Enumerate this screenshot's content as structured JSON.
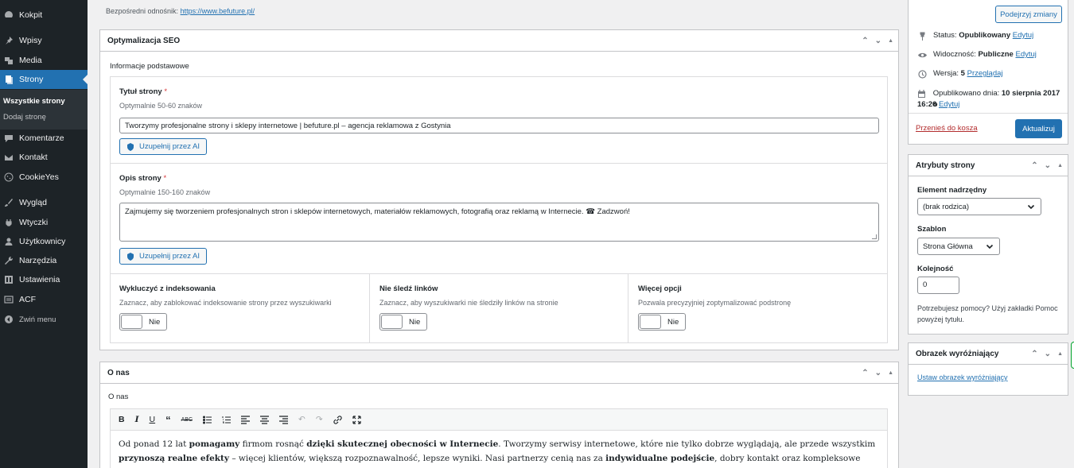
{
  "sidebar": {
    "items": [
      {
        "label": "Kokpit",
        "icon": "dashboard-icon"
      },
      {
        "label": "Wpisy",
        "icon": "pin-icon"
      },
      {
        "label": "Media",
        "icon": "media-icon"
      },
      {
        "label": "Strony",
        "icon": "pages-icon",
        "active": true
      },
      {
        "label": "Komentarze",
        "icon": "comments-icon"
      },
      {
        "label": "Kontakt",
        "icon": "mail-icon"
      },
      {
        "label": "CookieYes",
        "icon": "cookie-icon"
      },
      {
        "label": "Wygląd",
        "icon": "brush-icon"
      },
      {
        "label": "Wtyczki",
        "icon": "plugin-icon"
      },
      {
        "label": "Użytkownicy",
        "icon": "users-icon"
      },
      {
        "label": "Narzędzia",
        "icon": "wrench-icon"
      },
      {
        "label": "Ustawienia",
        "icon": "settings-icon"
      },
      {
        "label": "ACF",
        "icon": "acf-icon"
      },
      {
        "label": "Zwiń menu",
        "icon": "collapse-icon"
      }
    ],
    "submenu": [
      "Wszystkie strony",
      "Dodaj stronę"
    ]
  },
  "permalink": {
    "label": "Bezpośredni odnośnik:",
    "url": "https://www.befuture.pl/"
  },
  "seo": {
    "title": "Optymalizacja SEO",
    "subtitle": "Informacje podstawowe",
    "page_title_label": "Tytuł strony",
    "page_title_hint": "Optymalnie 50-60 znaków",
    "page_title_value": "Tworzymy profesjonalne strony i sklepy internetowe | befuture.pl – agencja reklamowa z Gostynia",
    "ai_button": "Uzupełnij przez AI",
    "desc_label": "Opis strony",
    "desc_hint": "Optymalnie 150-160 znaków",
    "desc_value": "Zajmujemy się tworzeniem profesjonalnych stron i sklepów internetowych, materiałów reklamowych, fotografią oraz reklamą w Internecie. ☎ Zadzwoń!",
    "required_mark": "*",
    "options": [
      {
        "label": "Wykluczyć z indeksowania",
        "hint": "Zaznacz, aby zablokować indeksowanie strony przez wyszukiwarki",
        "toggle": "Nie"
      },
      {
        "label": "Nie śledź linków",
        "hint": "Zaznacz, aby wyszukiwarki nie śledziły linków na stronie",
        "toggle": "Nie"
      },
      {
        "label": "Więcej opcji",
        "hint": "Pozwala precyzyjniej zoptymalizować podstronę",
        "toggle": "Nie"
      }
    ]
  },
  "about": {
    "title": "O nas",
    "subtitle": "O nas",
    "p1_a": "Od ponad 12 lat ",
    "p1_b": "pomagamy",
    "p1_c": " firmom rosnąć ",
    "p1_d": "dzięki skutecznej obecności w Internecie",
    "p1_e": ". Tworzymy serwisy internetowe, które nie tylko dobrze wyglądają, ale przede wszystkim ",
    "p1_f": "przynoszą realne efekty",
    "p1_g": " – więcej klientów, większą rozpoznawalność, lepsze wyniki. Nasi partnerzy cenią nas za ",
    "p1_h": "indywidualne podejście",
    "p1_i": ", dobry kontakt oraz kompleksowe rozwiązania."
  },
  "publish": {
    "preview_button": "Podejrzyj zmiany",
    "status_label": "Status:",
    "status_value": "Opublikowany",
    "visibility_label": "Widoczność:",
    "visibility_value": "Publiczne",
    "edit_link": "Edytuj",
    "version_label": "Wersja:",
    "version_value": "5",
    "browse_link": "Przeglądaj",
    "published_label": "Opublikowano dnia:",
    "published_value": "10 sierpnia 2017 o",
    "published_time": "16:26",
    "trash_link": "Przenieś do kosza",
    "update_button": "Aktualizuj"
  },
  "attributes": {
    "title": "Atrybuty strony",
    "parent_label": "Element nadrzędny",
    "parent_value": "(brak rodzica)",
    "template_label": "Szablon",
    "template_value": "Strona Główna",
    "order_label": "Kolejność",
    "order_value": "0",
    "help": "Potrzebujesz pomocy? Użyj zakładki Pomoc powyżej tytułu."
  },
  "featured": {
    "title": "Obrazek wyróżniający",
    "set_link": "Ustaw obrazek wyróżniający"
  },
  "colors": {
    "accent": "#2271b1",
    "sidebar": "#1d2327",
    "required": "#d63638",
    "trash": "#b32d2e"
  }
}
